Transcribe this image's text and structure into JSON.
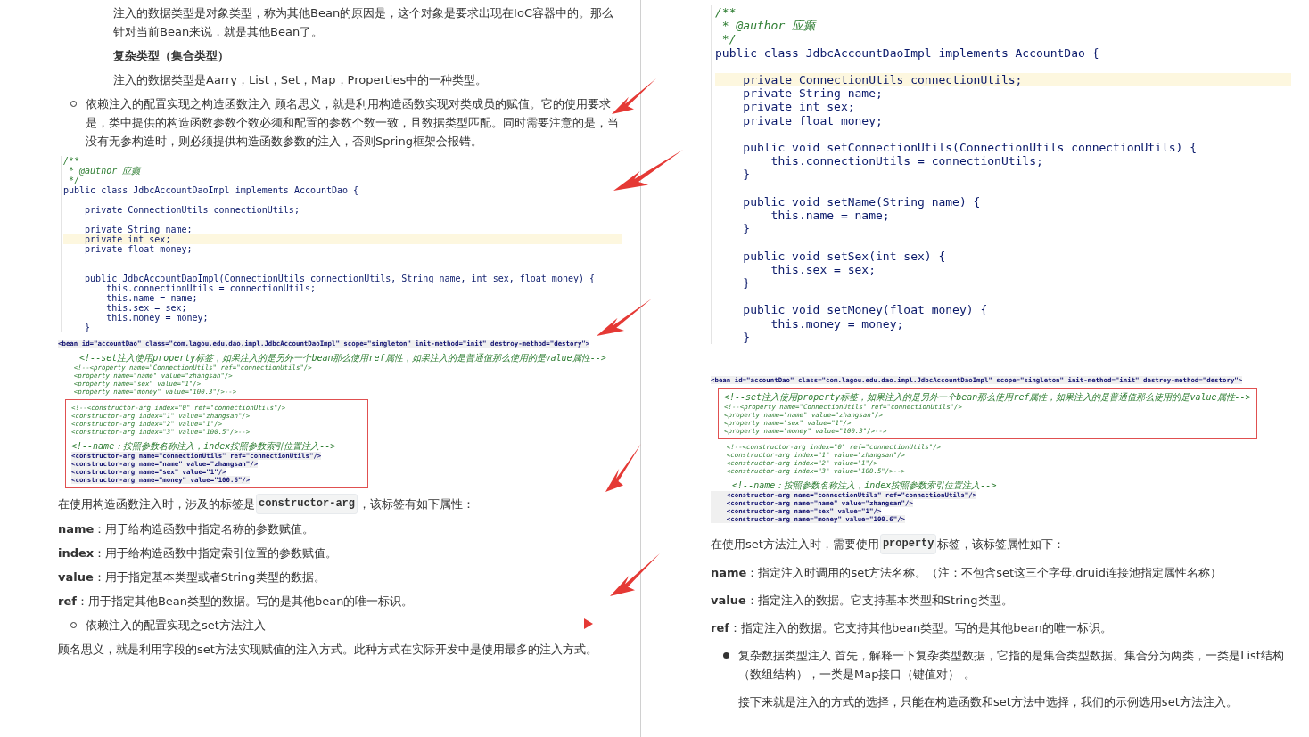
{
  "left": {
    "blocks": [
      {
        "kind": "subpara",
        "text": "注入的数据类型是对象类型，称为其他Bean的原因是，这个对象是要求出现在IoC容器中的。那么针对当前Bean来说，就是其他Bean了。"
      },
      {
        "kind": "heading",
        "text": "复杂类型（集合类型）"
      },
      {
        "kind": "subpara",
        "text": "注入的数据类型是Aarry，List，Set，Map，Properties中的一种类型。"
      },
      {
        "kind": "bullet",
        "text": "依赖注入的配置实现之构造函数注入 顾名思义，就是利用构造函数实现对类成员的赋值。它的使用要求是，类中提供的构造函数参数个数必须和配置的参数个数一致，且数据类型匹配。同时需要注意的是，当没有无参构造时，则必须提供构造函数参数的注入，否则Spring框架会报错。"
      },
      {
        "kind": "snippet",
        "lines": [
          {
            "kind": "comment",
            "text": "/**"
          },
          {
            "kind": "comment",
            "text": " * @author 应癫"
          },
          {
            "kind": "comment",
            "text": " */"
          },
          {
            "kind": "code",
            "text": "public class JdbcAccountDaoImpl implements AccountDao {"
          },
          {
            "kind": "blank"
          },
          {
            "kind": "code",
            "text": "    private ConnectionUtils connectionUtils;"
          },
          {
            "kind": "blank"
          },
          {
            "kind": "code",
            "text": "    private String name;"
          },
          {
            "kind": "current",
            "text": "    private int sex;"
          },
          {
            "kind": "code",
            "text": "    private float money;"
          },
          {
            "kind": "blank"
          },
          {
            "kind": "blank"
          },
          {
            "kind": "code",
            "text": "    public JdbcAccountDaoImpl(ConnectionUtils connectionUtils, String name, int sex, float money) {"
          },
          {
            "kind": "code",
            "text": "        this.connectionUtils = connectionUtils;"
          },
          {
            "kind": "code",
            "text": "        this.name = name;"
          },
          {
            "kind": "code",
            "text": "        this.sex = sex;"
          },
          {
            "kind": "code",
            "text": "        this.money = money;"
          },
          {
            "kind": "code",
            "text": "    }"
          }
        ]
      },
      {
        "kind": "xml",
        "sections": [
          {
            "boxed": false,
            "lines": [
              {
                "kind": "tag",
                "text": "<bean id=\"accountDao\" class=\"com.lagou.edu.dao.impl.JdbcAccountDaoImpl\" scope=\"singleton\" init-method=\"init\" destroy-method=\"destory\">"
              },
              {
                "kind": "blank"
              },
              {
                "kind": "note",
                "text": "    <!--set注入使用property标签，如果注入的是另外一个bean那么使用ref属性，如果注入的是普通值那么使用的是value属性-->"
              },
              {
                "kind": "comment",
                "text": "    <!--<property name=\"ConnectionUtils\" ref=\"connectionUtils\"/>"
              },
              {
                "kind": "comment",
                "text": "    <property name=\"name\" value=\"zhangsan\"/>"
              },
              {
                "kind": "comment",
                "text": "    <property name=\"sex\" value=\"1\"/>"
              },
              {
                "kind": "comment",
                "text": "    <property name=\"money\" value=\"100.3\"/>-->"
              }
            ]
          },
          {
            "boxed": true,
            "lines": [
              {
                "kind": "comment",
                "text": "<!--<constructor-arg index=\"0\" ref=\"connectionUtils\"/>"
              },
              {
                "kind": "comment",
                "text": "<constructor-arg index=\"1\" value=\"zhangsan\"/>"
              },
              {
                "kind": "comment",
                "text": "<constructor-arg index=\"2\" value=\"1\"/>"
              },
              {
                "kind": "comment",
                "text": "<constructor-arg index=\"3\" value=\"100.5\"/>-->"
              },
              {
                "kind": "blank"
              },
              {
                "kind": "note",
                "text": "<!--name：按照参数名称注入，index按照参数索引位置注入-->"
              },
              {
                "kind": "tag",
                "text": "<constructor-arg name=\"connectionUtils\" ref=\"connectionUtils\"/>"
              },
              {
                "kind": "tag",
                "text": "<constructor-arg name=\"name\" value=\"zhangsan\"/>"
              },
              {
                "kind": "tag",
                "text": "<constructor-arg name=\"sex\" value=\"1\"/>"
              },
              {
                "kind": "tag",
                "text": "<constructor-arg name=\"money\" value=\"100.6\"/>"
              }
            ]
          }
        ]
      },
      {
        "kind": "para_code",
        "before": "在使用构造函数注入时，涉及的标签是",
        "code": "constructor-arg",
        "after": "，该标签有如下属性："
      },
      {
        "kind": "para",
        "text": "**name**：用于给构造函数中指定名称的参数赋值。"
      },
      {
        "kind": "para",
        "text": "**index**：用于给构造函数中指定索引位置的参数赋值。"
      },
      {
        "kind": "para",
        "text": "**value**：用于指定基本类型或者String类型的数据。"
      },
      {
        "kind": "para",
        "text": "**ref**：用于指定其他Bean类型的数据。写的是其他bean的唯一标识。"
      },
      {
        "kind": "bullet",
        "text": "依赖注入的配置实现之set方法注入"
      },
      {
        "kind": "para",
        "text": "顾名思义，就是利用字段的set方法实现赋值的注入方式。此种方式在实际开发中是使用最多的注入方式。"
      }
    ]
  },
  "right": {
    "blocks": [
      {
        "kind": "code",
        "lines": [
          {
            "kind": "comment",
            "text": "/**"
          },
          {
            "kind": "comment",
            "text": " * @author 应癫"
          },
          {
            "kind": "comment",
            "text": " */"
          },
          {
            "kind": "code",
            "text": "public class JdbcAccountDaoImpl implements AccountDao {"
          },
          {
            "kind": "blank"
          },
          {
            "kind": "current",
            "text": "    private ConnectionUtils connectionUtils;"
          },
          {
            "kind": "code",
            "text": "    private String name;"
          },
          {
            "kind": "code",
            "text": "    private int sex;"
          },
          {
            "kind": "code",
            "text": "    private float money;"
          },
          {
            "kind": "blank"
          },
          {
            "kind": "code",
            "text": "    public void setConnectionUtils(ConnectionUtils connectionUtils) {"
          },
          {
            "kind": "code",
            "text": "        this.connectionUtils = connectionUtils;"
          },
          {
            "kind": "code",
            "text": "    }"
          },
          {
            "kind": "blank"
          },
          {
            "kind": "code",
            "text": "    public void setName(String name) {"
          },
          {
            "kind": "code",
            "text": "        this.name = name;"
          },
          {
            "kind": "code",
            "text": "    }"
          },
          {
            "kind": "blank"
          },
          {
            "kind": "code",
            "text": "    public void setSex(int sex) {"
          },
          {
            "kind": "code",
            "text": "        this.sex = sex;"
          },
          {
            "kind": "code",
            "text": "    }"
          },
          {
            "kind": "blank"
          },
          {
            "kind": "code",
            "text": "    public void setMoney(float money) {"
          },
          {
            "kind": "code",
            "text": "        this.money = money;"
          },
          {
            "kind": "code",
            "text": "    }"
          }
        ]
      },
      {
        "kind": "xml",
        "sections": [
          {
            "boxed": false,
            "lines": [
              {
                "kind": "tag",
                "text": "<bean id=\"accountDao\" class=\"com.lagou.edu.dao.impl.JdbcAccountDaoImpl\" scope=\"singleton\" init-method=\"init\" destroy-method=\"destory\">"
              }
            ]
          },
          {
            "boxed": true,
            "lines": [
              {
                "kind": "note",
                "text": "<!--set注入使用property标签，如果注入的是另外一个bean那么使用ref属性，如果注入的是普通值那么使用的是value属性-->"
              },
              {
                "kind": "comment",
                "text": "<!--<property name=\"ConnectionUtils\" ref=\"connectionUtils\"/>"
              },
              {
                "kind": "comment",
                "text": "<property name=\"name\" value=\"zhangsan\"/>"
              },
              {
                "kind": "comment",
                "text": "<property name=\"sex\" value=\"1\"/>"
              },
              {
                "kind": "comment",
                "text": "<property name=\"money\" value=\"100.3\"/>-->"
              }
            ]
          },
          {
            "boxed": false,
            "lines": [
              {
                "kind": "comment",
                "text": "    <!--<constructor-arg index=\"0\" ref=\"connectionUtils\"/>"
              },
              {
                "kind": "comment",
                "text": "    <constructor-arg index=\"1\" value=\"zhangsan\"/>"
              },
              {
                "kind": "comment",
                "text": "    <constructor-arg index=\"2\" value=\"1\"/>"
              },
              {
                "kind": "comment",
                "text": "    <constructor-arg index=\"3\" value=\"100.5\"/>-->"
              },
              {
                "kind": "blank"
              },
              {
                "kind": "note",
                "text": "    <!--name：按照参数名称注入，index按照参数索引位置注入-->"
              },
              {
                "kind": "tag",
                "text": "    <constructor-arg name=\"connectionUtils\" ref=\"connectionUtils\"/>"
              },
              {
                "kind": "tag",
                "text": "    <constructor-arg name=\"name\" value=\"zhangsan\"/>"
              },
              {
                "kind": "tag",
                "text": "    <constructor-arg name=\"sex\" value=\"1\"/>"
              },
              {
                "kind": "tag",
                "text": "    <constructor-arg name=\"money\" value=\"100.6\"/>"
              }
            ]
          }
        ]
      },
      {
        "kind": "para_code",
        "before": "在使用set方法注入时，需要使用",
        "code": "property",
        "after": "标签，该标签属性如下："
      },
      {
        "kind": "para",
        "text": "**name**：指定注入时调用的set方法名称。（注：不包含set这三个字母,druid连接池指定属性名称）"
      },
      {
        "kind": "para",
        "text": "**value**：指定注入的数据。它支持基本类型和String类型。"
      },
      {
        "kind": "para",
        "text": "**ref**：指定注入的数据。它支持其他bean类型。写的是其他bean的唯一标识。"
      },
      {
        "kind": "dotbullet",
        "text": "复杂数据类型注入 首先，解释一下复杂类型数据，它指的是集合类型数据。集合分为两类，一类是List结构（数组结构），一类是Map接口（键值对） 。"
      },
      {
        "kind": "itempara",
        "text": "接下来就是注入的方式的选择，只能在构造函数和set方法中选择，我们的示例选用set方法注入。"
      }
    ]
  }
}
